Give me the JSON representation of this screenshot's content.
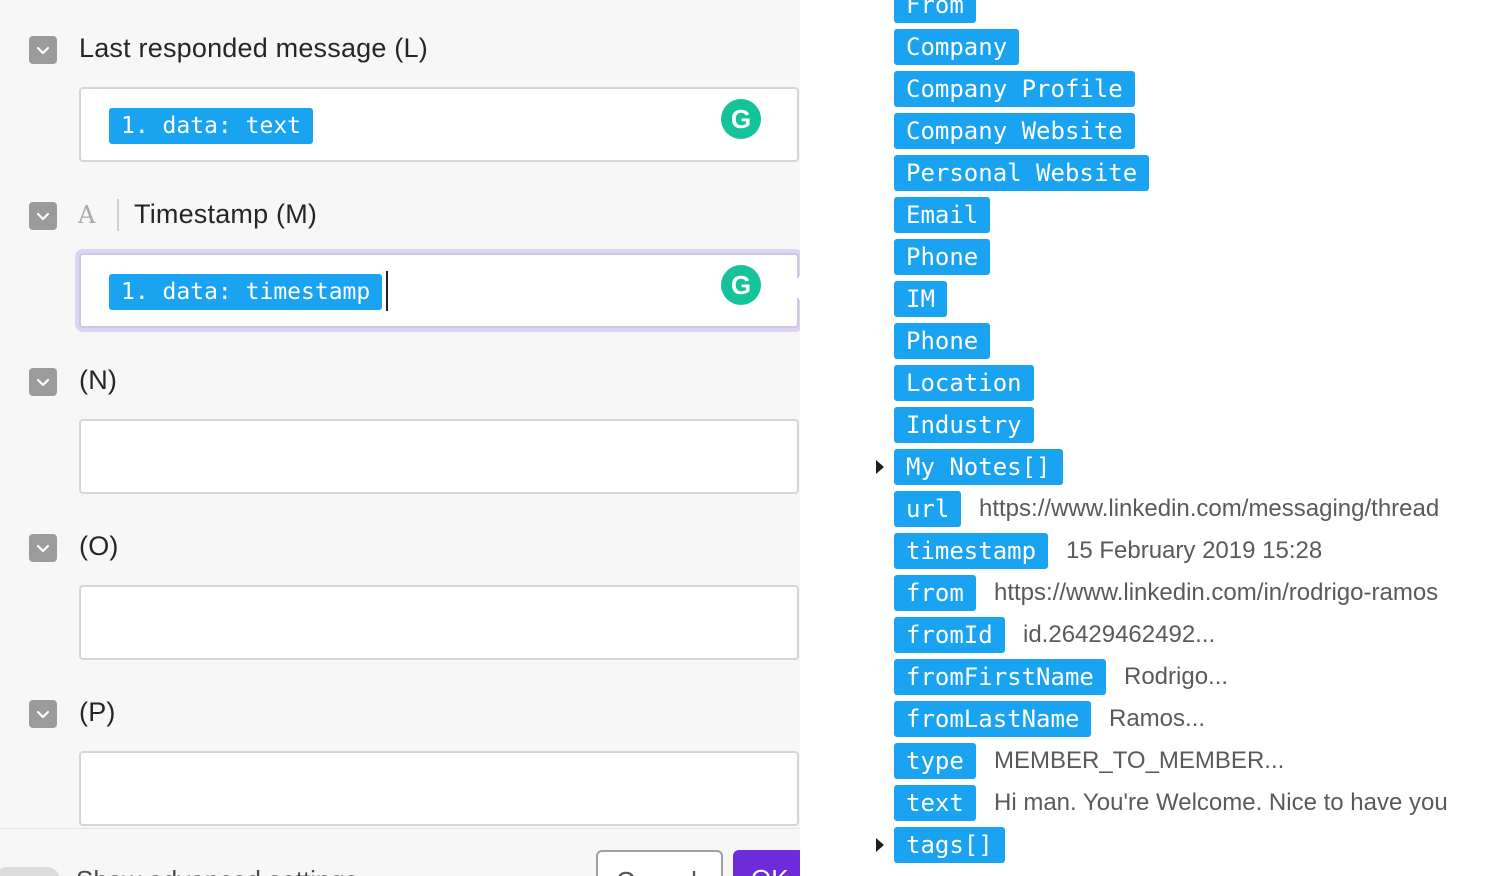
{
  "fields": [
    {
      "label": "Last responded message (L)",
      "token": "1. data: text",
      "has_type_icon": false
    },
    {
      "type_icon": "A",
      "label": "Timestamp (M)",
      "token": "1. data: timestamp",
      "focused": true
    },
    {
      "label": "(N)",
      "token": ""
    },
    {
      "label": "(O)",
      "token": ""
    },
    {
      "label": "(P)",
      "token": ""
    }
  ],
  "grammarly_icon": "G",
  "footer": {
    "advanced_label": "Show advanced settings",
    "cancel_label": "Cancel",
    "ok_label": "OK"
  },
  "tree": [
    {
      "key": "From",
      "value": ""
    },
    {
      "key": "Company",
      "value": ""
    },
    {
      "key": "Company Profile",
      "value": ""
    },
    {
      "key": "Company Website",
      "value": ""
    },
    {
      "key": "Personal Website",
      "value": ""
    },
    {
      "key": "Email",
      "value": ""
    },
    {
      "key": "Phone",
      "value": ""
    },
    {
      "key": "IM",
      "value": ""
    },
    {
      "key": "Phone",
      "value": ""
    },
    {
      "key": "Location",
      "value": ""
    },
    {
      "key": "Industry",
      "value": ""
    },
    {
      "key": "My Notes[]",
      "value": "",
      "expandable": true
    },
    {
      "key": "url",
      "value": "https://www.linkedin.com/messaging/thread"
    },
    {
      "key": "timestamp",
      "value": "15 February 2019 15:28"
    },
    {
      "key": "from",
      "value": "https://www.linkedin.com/in/rodrigo-ramos"
    },
    {
      "key": "fromId",
      "value": "id.26429462492..."
    },
    {
      "key": "fromFirstName",
      "value": "Rodrigo..."
    },
    {
      "key": "fromLastName",
      "value": "Ramos..."
    },
    {
      "key": "type",
      "value": "MEMBER_TO_MEMBER..."
    },
    {
      "key": "text",
      "value": "Hi man. You're Welcome. Nice to have you"
    },
    {
      "key": "tags[]",
      "value": "",
      "expandable": true
    }
  ],
  "colors": {
    "token_bg": "#1aa3f0",
    "checkbox": "#9b9b9b",
    "grammarly": "#15c39a",
    "ok_button": "#6d2bd9",
    "focus_ring": "#ddd3f3"
  }
}
